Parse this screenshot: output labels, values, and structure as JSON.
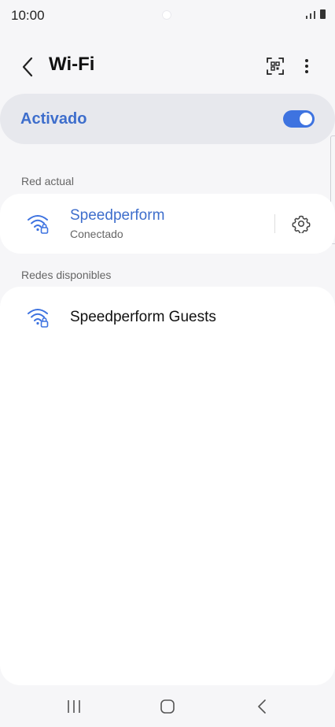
{
  "status_bar": {
    "time": "10:00"
  },
  "header": {
    "title": "Wi-Fi"
  },
  "toggle": {
    "label": "Activado",
    "state": "on",
    "accent_color": "#3e73e0"
  },
  "current_network": {
    "section_label": "Red actual",
    "name": "Speedperform",
    "status": "Conectado",
    "icon": "wifi-locked-icon"
  },
  "available_networks": {
    "section_label": "Redes disponibles",
    "items": [
      {
        "name": "Speedperform Guests",
        "icon": "wifi-locked-icon"
      }
    ]
  },
  "nav": {
    "icons": [
      "recent-apps-icon",
      "home-icon",
      "back-icon"
    ]
  }
}
